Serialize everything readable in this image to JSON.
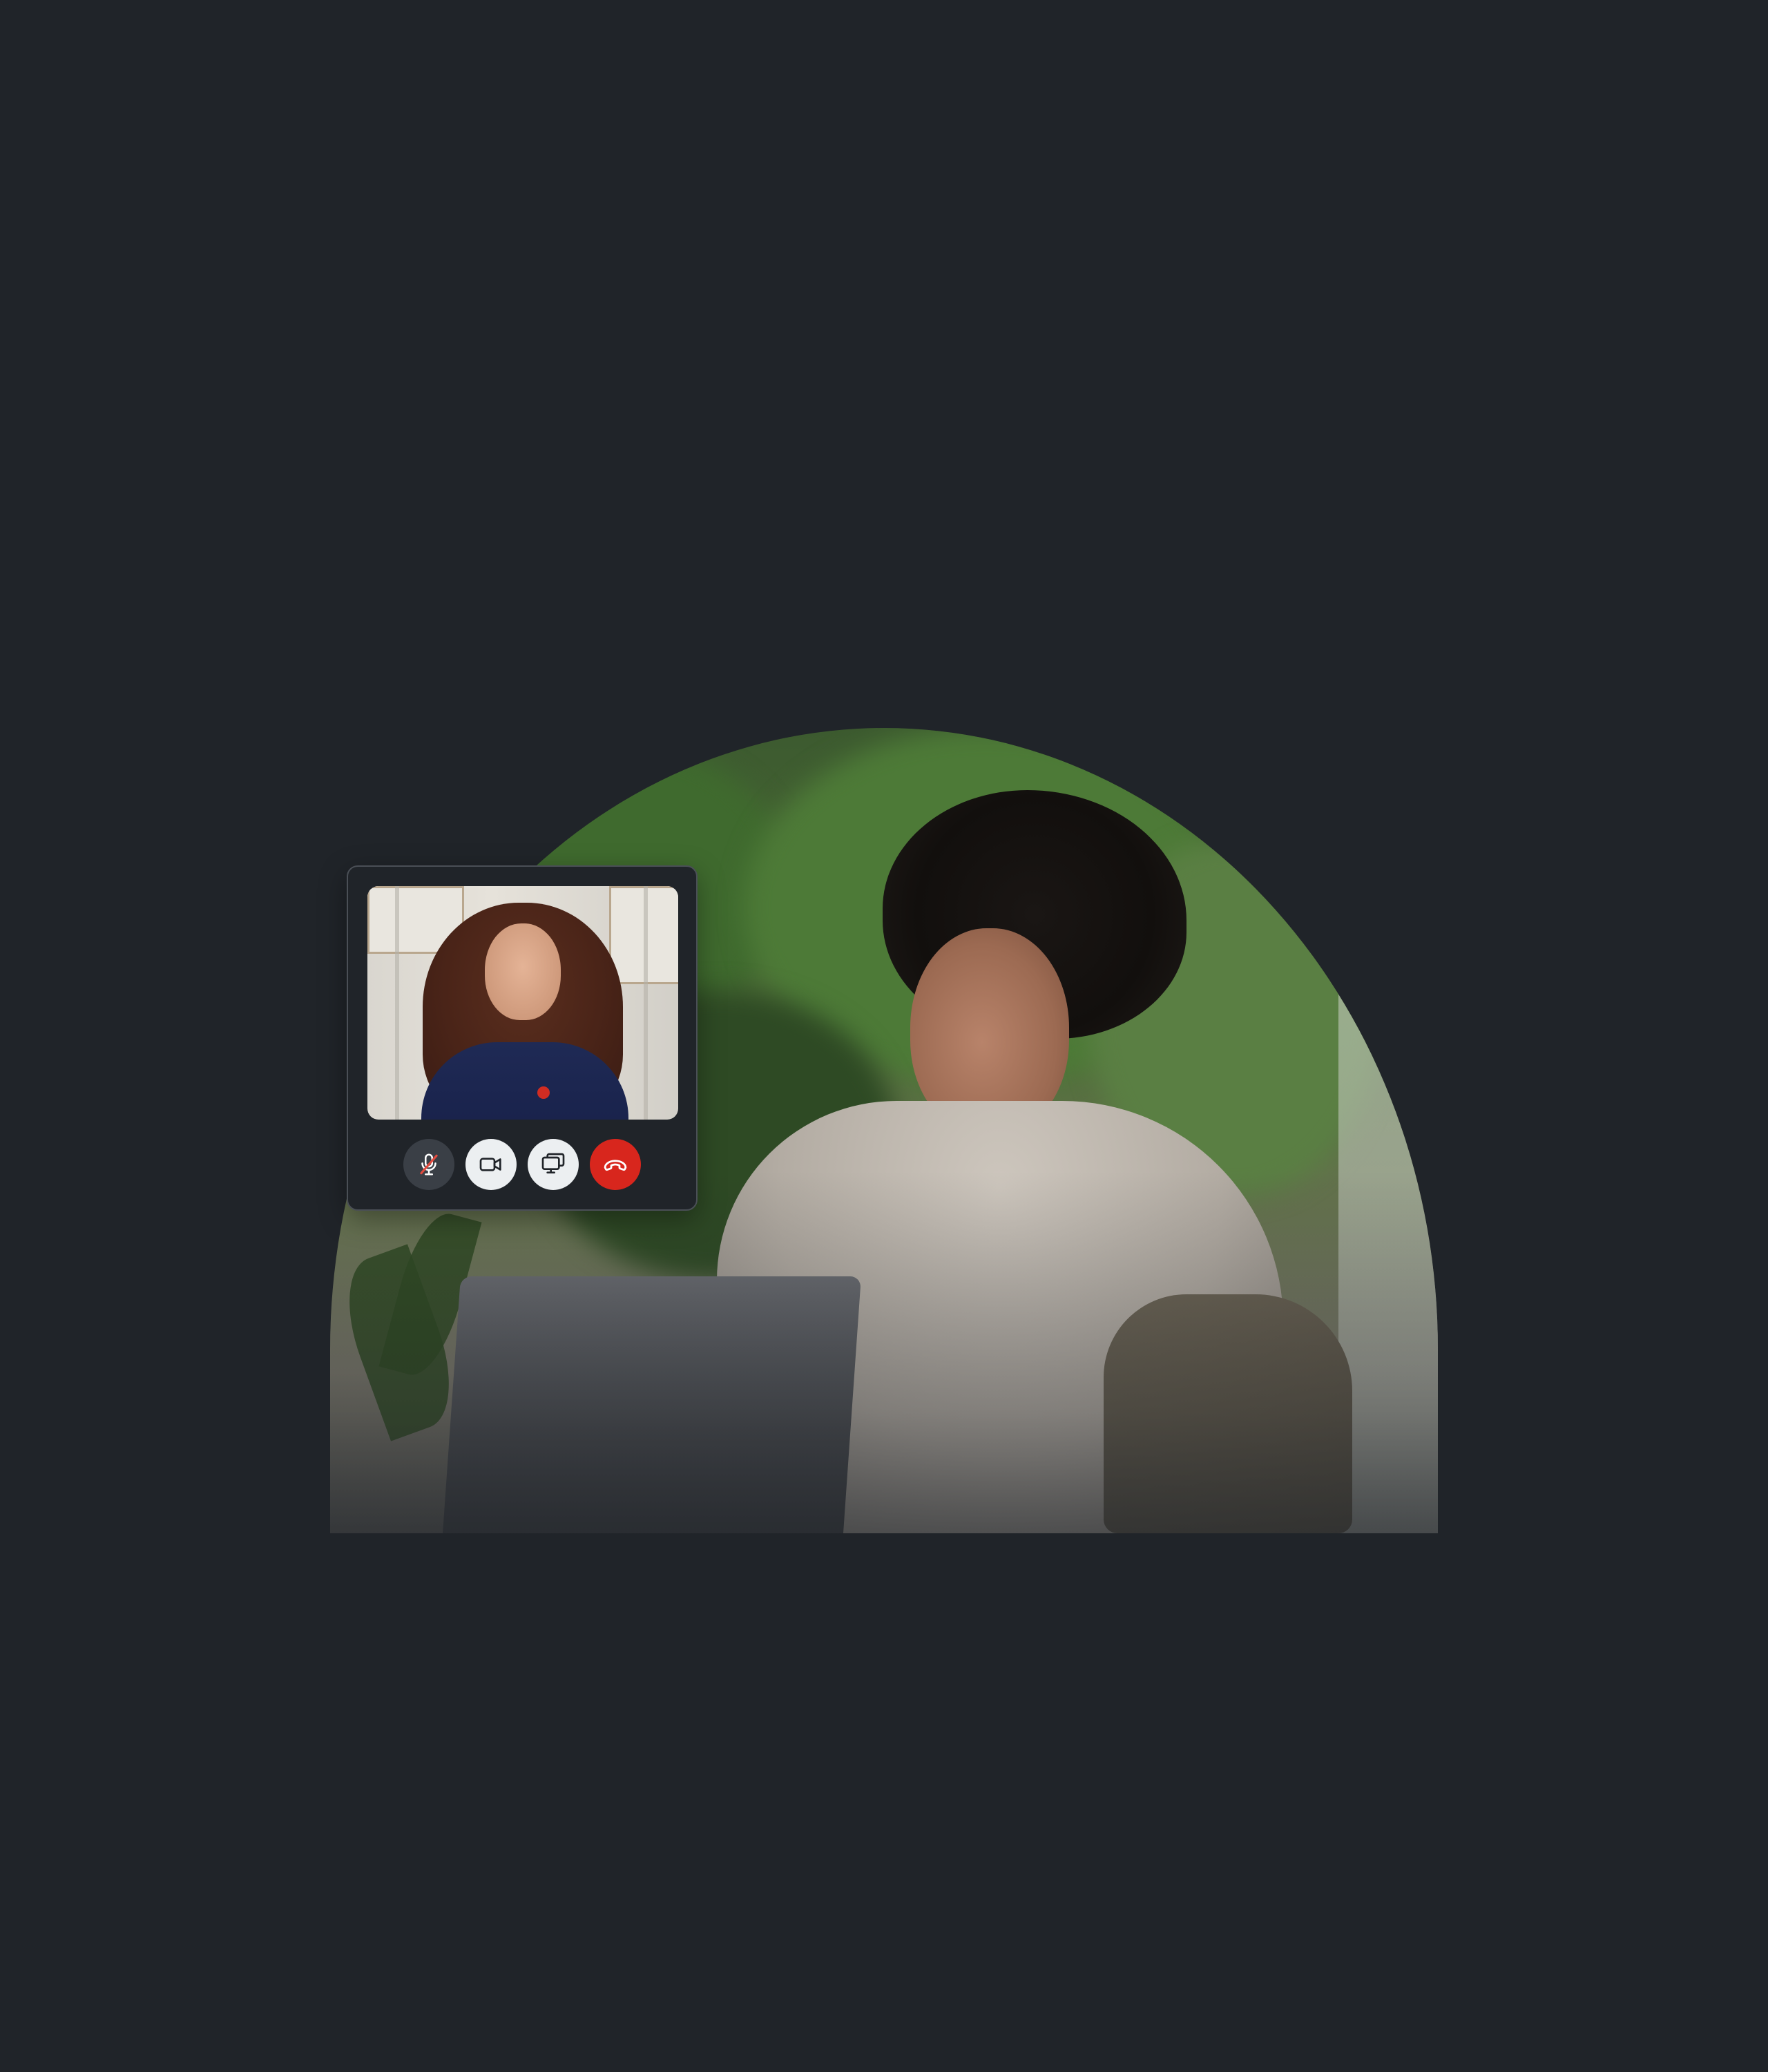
{
  "call": {
    "buttons": [
      {
        "id": "mute",
        "icon": "microphone-muted-icon",
        "label": ""
      },
      {
        "id": "video",
        "icon": "video-camera-icon",
        "label": ""
      },
      {
        "id": "share",
        "icon": "screen-share-icon",
        "label": ""
      },
      {
        "id": "end",
        "icon": "phone-hangup-icon",
        "label": ""
      }
    ]
  },
  "colors": {
    "background": "#202429",
    "card_background": "#202429",
    "card_border": "#4a4f56",
    "mute_button": "#3a3f46",
    "light_button": "#eceff1",
    "end_call_button": "#d8261d",
    "mute_slash": "#e24b3f"
  }
}
